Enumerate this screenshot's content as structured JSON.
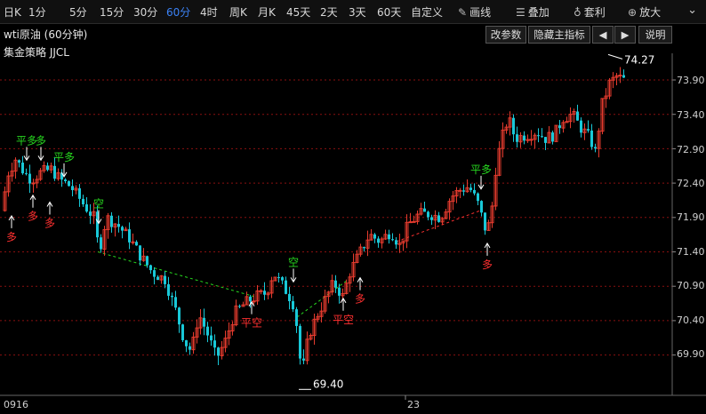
{
  "toolbar": {
    "items": [
      "日K",
      "1分",
      "5分",
      "15分",
      "30分",
      "60分",
      "4时",
      "周K",
      "月K",
      "45天",
      "2天",
      "3天",
      "60天",
      "自定义"
    ],
    "active": "60分",
    "draw": {
      "icon": "pencil-icon",
      "label": "画线"
    },
    "overlay": {
      "icon": "stack-icon",
      "label": "叠加"
    },
    "arbitrage": {
      "icon": "money-bag-icon",
      "label": "套利"
    },
    "zoom": {
      "icon": "zoom-in-icon",
      "label": "放大"
    }
  },
  "chart_title": "wti原油 (60分钟)",
  "buttons": {
    "edit_params": "改参数",
    "hide_main": "隐藏主指标",
    "prev": "◀",
    "next": "▶",
    "help": "说明"
  },
  "strategy": "集金策略 JJCL",
  "colors": {
    "up": "#e63b2e",
    "down": "#18c8d8",
    "grid": "#8a1010",
    "signal_green": "#27d81f",
    "signal_red": "#ff3030",
    "background": "#000000"
  },
  "chart_data": {
    "type": "candlestick",
    "y_ticks": [
      "73.90",
      "73.40",
      "72.90",
      "72.40",
      "71.90",
      "71.40",
      "70.90",
      "70.40",
      "69.90"
    ],
    "x_labels": [
      "0916",
      "23"
    ],
    "high_label": "74.27",
    "low_label": "69.40",
    "signals": [
      {
        "text": "多",
        "color": "red",
        "pos": "below"
      },
      {
        "text": "平多",
        "color": "green",
        "pos": "above"
      },
      {
        "text": "多",
        "color": "red",
        "pos": "below"
      },
      {
        "text": "多",
        "color": "green",
        "pos": "above"
      },
      {
        "text": "多",
        "color": "red",
        "pos": "below"
      },
      {
        "text": "平多",
        "color": "green",
        "pos": "above"
      },
      {
        "text": "空",
        "color": "green",
        "pos": "above"
      },
      {
        "text": "平空",
        "color": "red",
        "pos": "below"
      },
      {
        "text": "空",
        "color": "green",
        "pos": "above"
      },
      {
        "text": "平空",
        "color": "red",
        "pos": "below"
      },
      {
        "text": "多",
        "color": "red",
        "pos": "below"
      },
      {
        "text": "平多",
        "color": "green",
        "pos": "above"
      },
      {
        "text": "多",
        "color": "red",
        "pos": "below"
      }
    ]
  }
}
